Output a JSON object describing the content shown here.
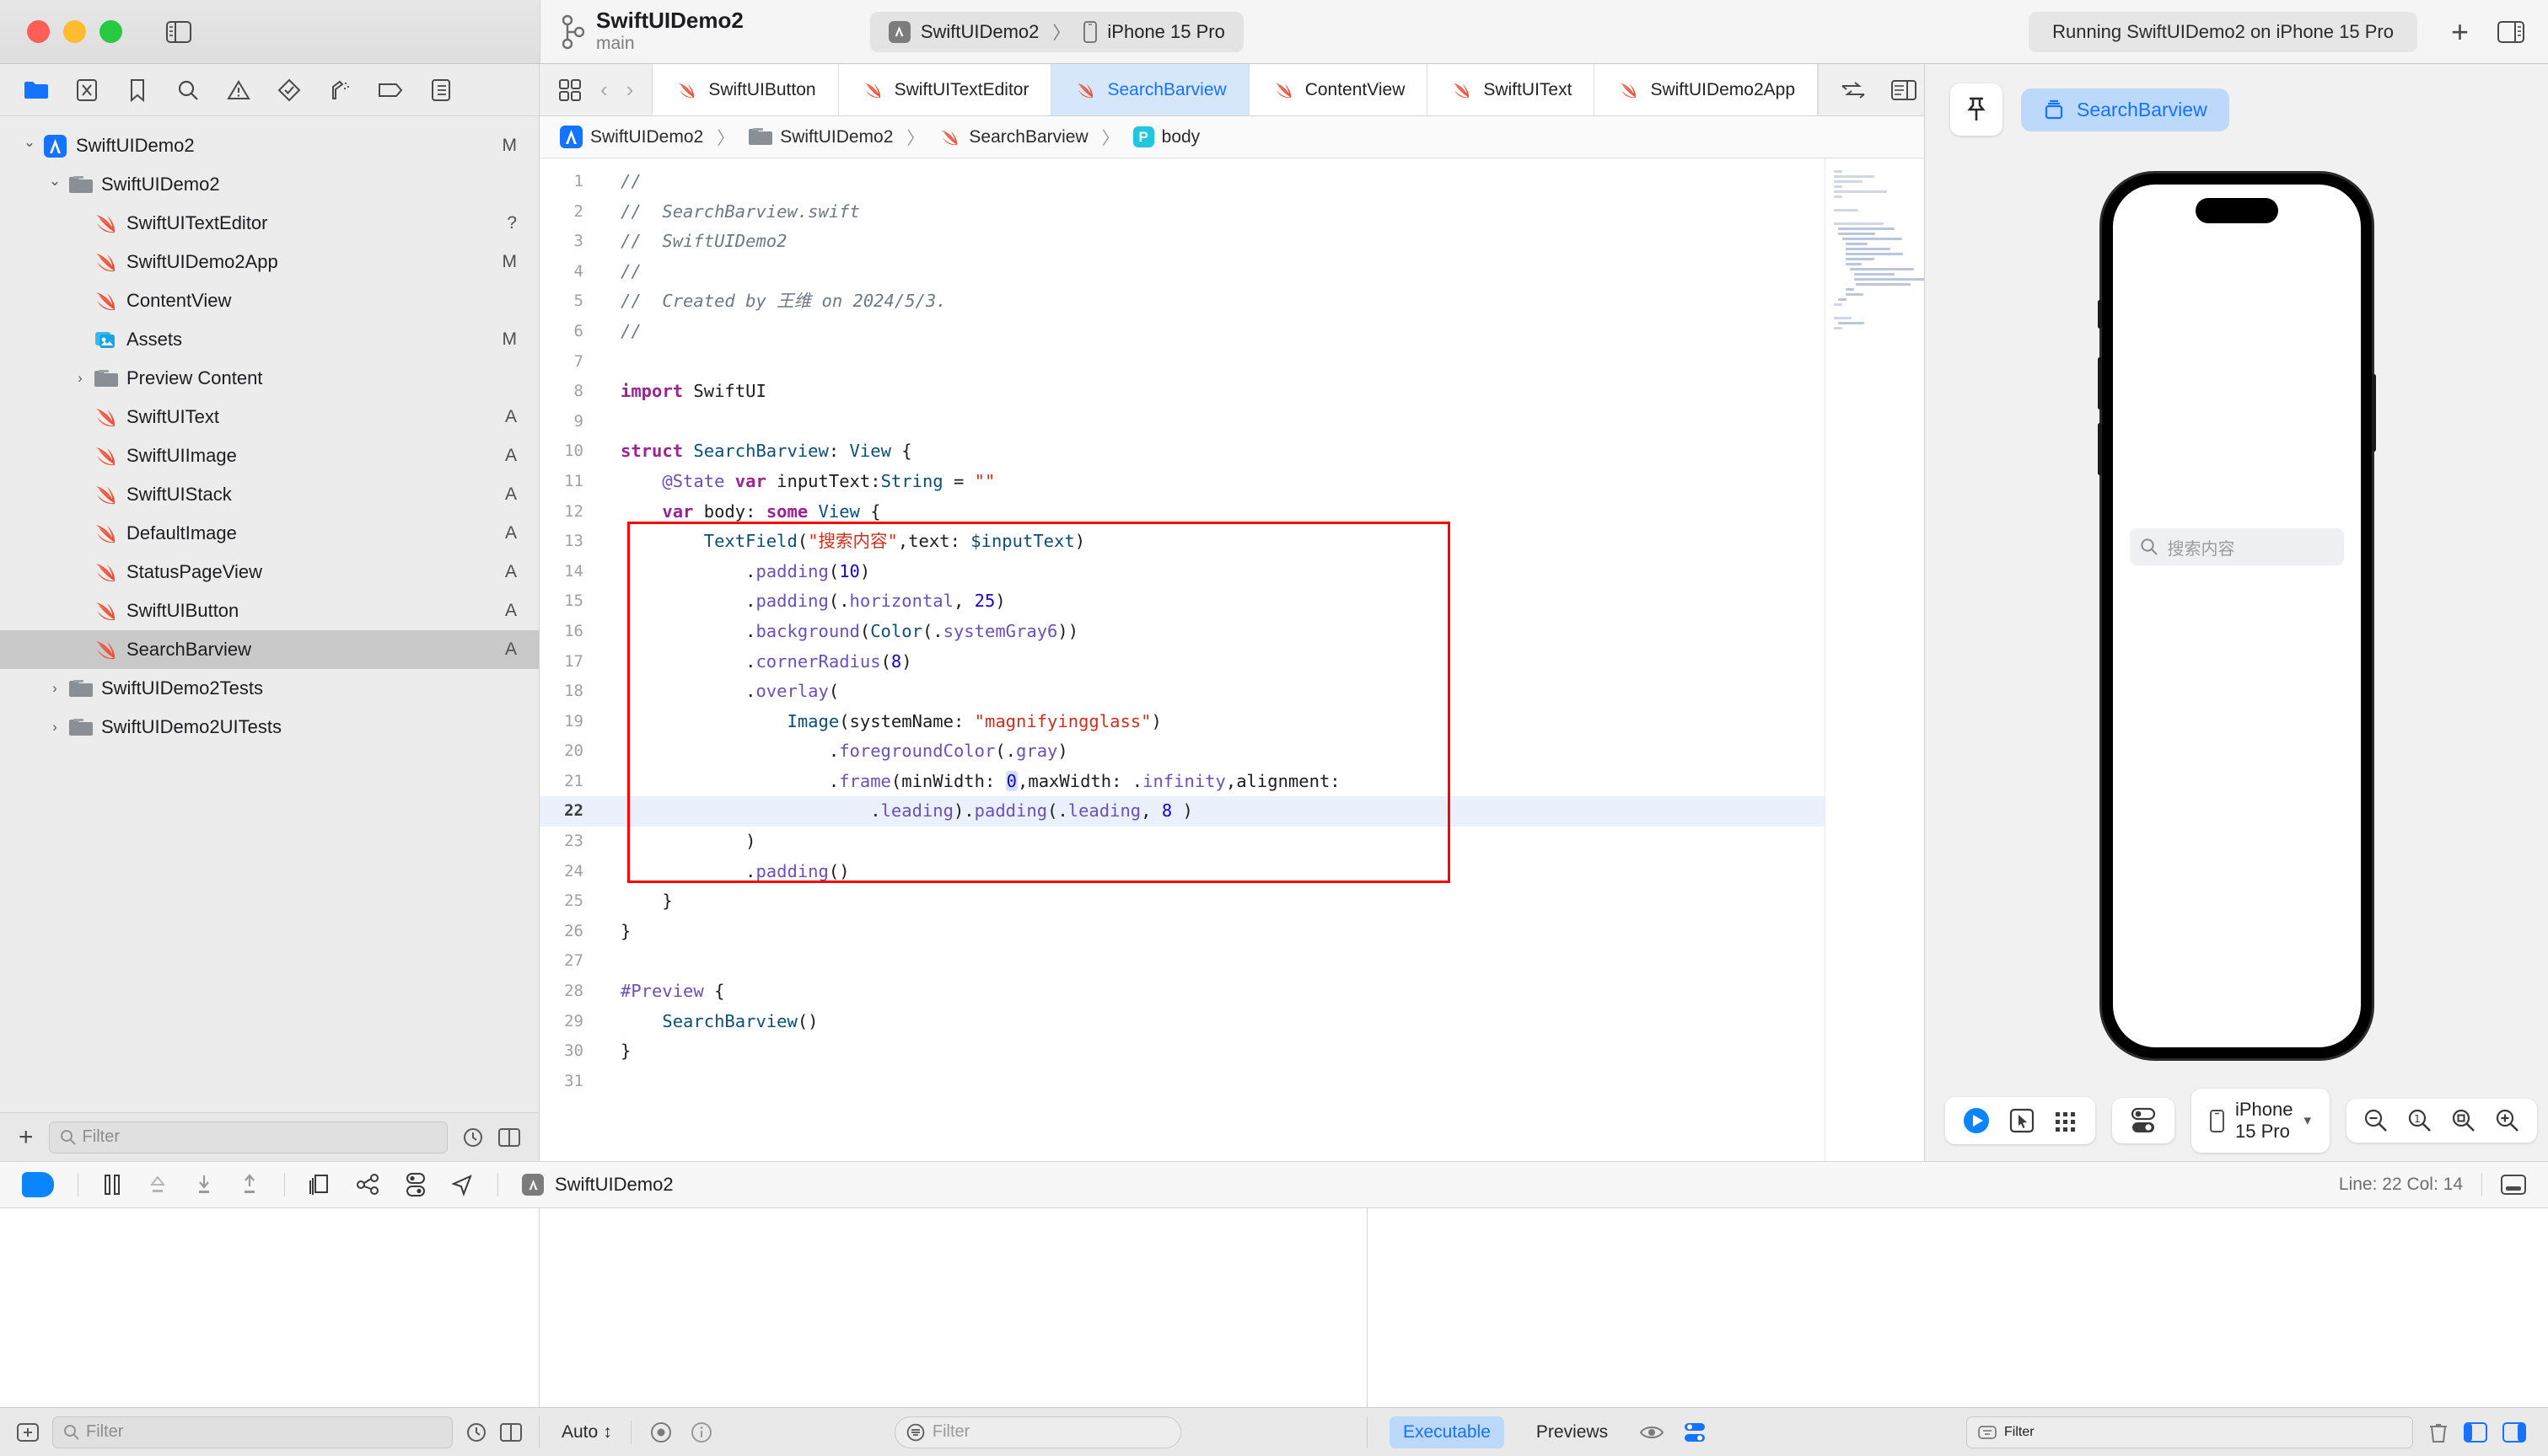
{
  "window": {
    "traffic_lights": [
      "close",
      "minimize",
      "zoom"
    ],
    "sidebar_toggle": "sidebar-toggle-icon",
    "stop_label": "stop-button",
    "run_label": "run-button"
  },
  "branch": {
    "project": "SwiftUIDemo2",
    "name": "main"
  },
  "scheme": {
    "target": "SwiftUIDemo2",
    "destination": "iPhone 15 Pro",
    "separator": "〉"
  },
  "activity": {
    "status": "Running SwiftUIDemo2 on iPhone 15 Pro"
  },
  "titlebar_actions": {
    "add": "+",
    "inspector_toggle": "inspector-toggle-icon"
  },
  "navigator": {
    "icons": [
      "folder-icon",
      "source-control-icon",
      "bookmark-icon",
      "search-icon",
      "warning-icon",
      "test-icon",
      "debug-icon",
      "breakpoint-icon",
      "report-icon"
    ],
    "tree": [
      {
        "label": "SwiftUIDemo2",
        "badge": "M",
        "icon": "app-icon",
        "depth": 0,
        "disclosure": "open",
        "selected": false
      },
      {
        "label": "SwiftUIDemo2",
        "badge": "",
        "icon": "folder-icon",
        "depth": 1,
        "disclosure": "open",
        "selected": false
      },
      {
        "label": "SwiftUITextEditor",
        "badge": "?",
        "icon": "swift-icon",
        "depth": 2,
        "disclosure": "",
        "selected": false
      },
      {
        "label": "SwiftUIDemo2App",
        "badge": "M",
        "icon": "swift-icon",
        "depth": 2,
        "disclosure": "",
        "selected": false
      },
      {
        "label": "ContentView",
        "badge": "",
        "icon": "swift-icon",
        "depth": 2,
        "disclosure": "",
        "selected": false
      },
      {
        "label": "Assets",
        "badge": "M",
        "icon": "assets-icon",
        "depth": 2,
        "disclosure": "",
        "selected": false
      },
      {
        "label": "Preview Content",
        "badge": "",
        "icon": "folder-icon",
        "depth": 2,
        "disclosure": "closed",
        "selected": false
      },
      {
        "label": "SwiftUIText",
        "badge": "A",
        "icon": "swift-icon",
        "depth": 2,
        "disclosure": "",
        "selected": false
      },
      {
        "label": "SwiftUIImage",
        "badge": "A",
        "icon": "swift-icon",
        "depth": 2,
        "disclosure": "",
        "selected": false
      },
      {
        "label": "SwiftUIStack",
        "badge": "A",
        "icon": "swift-icon",
        "depth": 2,
        "disclosure": "",
        "selected": false
      },
      {
        "label": "DefaultImage",
        "badge": "A",
        "icon": "swift-icon",
        "depth": 2,
        "disclosure": "",
        "selected": false
      },
      {
        "label": "StatusPageView",
        "badge": "A",
        "icon": "swift-icon",
        "depth": 2,
        "disclosure": "",
        "selected": false
      },
      {
        "label": "SwiftUIButton",
        "badge": "A",
        "icon": "swift-icon",
        "depth": 2,
        "disclosure": "",
        "selected": false
      },
      {
        "label": "SearchBarview",
        "badge": "A",
        "icon": "swift-icon",
        "depth": 2,
        "disclosure": "",
        "selected": true
      },
      {
        "label": "SwiftUIDemo2Tests",
        "badge": "",
        "icon": "folder-icon",
        "depth": 1,
        "disclosure": "closed",
        "selected": false
      },
      {
        "label": "SwiftUIDemo2UITests",
        "badge": "",
        "icon": "folder-icon",
        "depth": 1,
        "disclosure": "closed",
        "selected": false
      }
    ],
    "filter_placeholder": "Filter",
    "add_button": "+"
  },
  "tabs": [
    {
      "label": "SwiftUIButton",
      "active": false
    },
    {
      "label": "SwiftUITextEditor",
      "active": false
    },
    {
      "label": "SearchBarview",
      "active": true
    },
    {
      "label": "ContentView",
      "active": false
    },
    {
      "label": "SwiftUIText",
      "active": false
    },
    {
      "label": "SwiftUIDemo2App",
      "active": false
    }
  ],
  "breadcrumb": [
    {
      "label": "SwiftUIDemo2",
      "icon": "app-icon"
    },
    {
      "label": "SwiftUIDemo2",
      "icon": "folder-icon"
    },
    {
      "label": "SearchBarview",
      "icon": "swift-icon"
    },
    {
      "label": "body",
      "icon": "property-badge"
    }
  ],
  "code": {
    "current_line": 22,
    "lines": [
      {
        "n": 1,
        "fold": false,
        "tokens": [
          {
            "t": "com",
            "v": "//"
          }
        ]
      },
      {
        "n": 2,
        "fold": true,
        "tokens": [
          {
            "t": "com",
            "v": "//  SearchBarview.swift"
          }
        ]
      },
      {
        "n": 3,
        "fold": true,
        "tokens": [
          {
            "t": "com",
            "v": "//  SwiftUIDemo2"
          }
        ]
      },
      {
        "n": 4,
        "fold": true,
        "tokens": [
          {
            "t": "com",
            "v": "//"
          }
        ]
      },
      {
        "n": 5,
        "fold": true,
        "tokens": [
          {
            "t": "com",
            "v": "//  Created by 王维 on 2024/5/3."
          }
        ]
      },
      {
        "n": 6,
        "fold": true,
        "tokens": [
          {
            "t": "com",
            "v": "//"
          }
        ]
      },
      {
        "n": 7,
        "fold": false,
        "tokens": []
      },
      {
        "n": 8,
        "fold": false,
        "tokens": [
          {
            "t": "kw",
            "v": "import"
          },
          {
            "t": "plain",
            "v": " SwiftUI"
          }
        ]
      },
      {
        "n": 9,
        "fold": false,
        "tokens": []
      },
      {
        "n": 10,
        "fold": true,
        "tokens": [
          {
            "t": "kw",
            "v": "struct"
          },
          {
            "t": "plain",
            "v": " "
          },
          {
            "t": "type",
            "v": "SearchBarview"
          },
          {
            "t": "plain",
            "v": ": "
          },
          {
            "t": "type",
            "v": "View"
          },
          {
            "t": "plain",
            "v": " {"
          }
        ]
      },
      {
        "n": 11,
        "fold": true,
        "tokens": [
          {
            "t": "plain",
            "v": "    "
          },
          {
            "t": "attr",
            "v": "@State"
          },
          {
            "t": "plain",
            "v": " "
          },
          {
            "t": "kw",
            "v": "var"
          },
          {
            "t": "plain",
            "v": " inputText:"
          },
          {
            "t": "type",
            "v": "String"
          },
          {
            "t": "plain",
            "v": " = "
          },
          {
            "t": "str",
            "v": "\"\""
          }
        ]
      },
      {
        "n": 12,
        "fold": true,
        "tokens": [
          {
            "t": "plain",
            "v": "    "
          },
          {
            "t": "kw",
            "v": "var"
          },
          {
            "t": "plain",
            "v": " body: "
          },
          {
            "t": "kw",
            "v": "some"
          },
          {
            "t": "plain",
            "v": " "
          },
          {
            "t": "type",
            "v": "View"
          },
          {
            "t": "plain",
            "v": " {"
          }
        ]
      },
      {
        "n": 13,
        "fold": true,
        "tokens": [
          {
            "t": "plain",
            "v": "        "
          },
          {
            "t": "type",
            "v": "TextField"
          },
          {
            "t": "plain",
            "v": "("
          },
          {
            "t": "str",
            "v": "\"搜索内容\""
          },
          {
            "t": "plain",
            "v": ",text: "
          },
          {
            "t": "type",
            "v": "$inputText"
          },
          {
            "t": "plain",
            "v": ")"
          }
        ]
      },
      {
        "n": 14,
        "fold": false,
        "tokens": [
          {
            "t": "plain",
            "v": "            ."
          },
          {
            "t": "meth",
            "v": "padding"
          },
          {
            "t": "plain",
            "v": "("
          },
          {
            "t": "num",
            "v": "10"
          },
          {
            "t": "plain",
            "v": ")"
          }
        ]
      },
      {
        "n": 15,
        "fold": false,
        "tokens": [
          {
            "t": "plain",
            "v": "            ."
          },
          {
            "t": "meth",
            "v": "padding"
          },
          {
            "t": "plain",
            "v": "(."
          },
          {
            "t": "meth",
            "v": "horizontal"
          },
          {
            "t": "plain",
            "v": ", "
          },
          {
            "t": "num",
            "v": "25"
          },
          {
            "t": "plain",
            "v": ")"
          }
        ]
      },
      {
        "n": 16,
        "fold": false,
        "tokens": [
          {
            "t": "plain",
            "v": "            ."
          },
          {
            "t": "meth",
            "v": "background"
          },
          {
            "t": "plain",
            "v": "("
          },
          {
            "t": "type",
            "v": "Color"
          },
          {
            "t": "plain",
            "v": "(."
          },
          {
            "t": "meth",
            "v": "systemGray6"
          },
          {
            "t": "plain",
            "v": "))"
          }
        ]
      },
      {
        "n": 17,
        "fold": false,
        "tokens": [
          {
            "t": "plain",
            "v": "            ."
          },
          {
            "t": "meth",
            "v": "cornerRadius"
          },
          {
            "t": "plain",
            "v": "("
          },
          {
            "t": "num",
            "v": "8"
          },
          {
            "t": "plain",
            "v": ")"
          }
        ]
      },
      {
        "n": 18,
        "fold": false,
        "tokens": [
          {
            "t": "plain",
            "v": "            ."
          },
          {
            "t": "meth",
            "v": "overlay"
          },
          {
            "t": "plain",
            "v": "("
          }
        ]
      },
      {
        "n": 19,
        "fold": false,
        "tokens": [
          {
            "t": "plain",
            "v": "                "
          },
          {
            "t": "type",
            "v": "Image"
          },
          {
            "t": "plain",
            "v": "(systemName: "
          },
          {
            "t": "str",
            "v": "\"magnifyingglass\""
          },
          {
            "t": "plain",
            "v": ")"
          }
        ]
      },
      {
        "n": 20,
        "fold": false,
        "tokens": [
          {
            "t": "plain",
            "v": "                    ."
          },
          {
            "t": "meth",
            "v": "foregroundColor"
          },
          {
            "t": "plain",
            "v": "(."
          },
          {
            "t": "meth",
            "v": "gray"
          },
          {
            "t": "plain",
            "v": ")"
          }
        ]
      },
      {
        "n": 21,
        "fold": false,
        "tokens": [
          {
            "t": "plain",
            "v": "                    ."
          },
          {
            "t": "meth",
            "v": "frame"
          },
          {
            "t": "plain",
            "v": "(minWidth: "
          },
          {
            "t": "numsel",
            "v": "0"
          },
          {
            "t": "plain",
            "v": ",maxWidth: ."
          },
          {
            "t": "meth",
            "v": "infinity"
          },
          {
            "t": "plain",
            "v": ",alignment:"
          }
        ]
      },
      {
        "n": 22,
        "fold": false,
        "tokens": [
          {
            "t": "plain",
            "v": "                        ."
          },
          {
            "t": "meth",
            "v": "leading"
          },
          {
            "t": "plain",
            "v": ")."
          },
          {
            "t": "meth",
            "v": "padding"
          },
          {
            "t": "plain",
            "v": "(."
          },
          {
            "t": "meth",
            "v": "leading"
          },
          {
            "t": "plain",
            "v": ", "
          },
          {
            "t": "num",
            "v": "8"
          },
          {
            "t": "plain",
            "v": " )"
          }
        ]
      },
      {
        "n": 23,
        "fold": false,
        "tokens": [
          {
            "t": "plain",
            "v": "            )"
          }
        ]
      },
      {
        "n": 24,
        "fold": false,
        "tokens": [
          {
            "t": "plain",
            "v": "            ."
          },
          {
            "t": "meth",
            "v": "padding"
          },
          {
            "t": "plain",
            "v": "()"
          }
        ]
      },
      {
        "n": 25,
        "fold": true,
        "tokens": [
          {
            "t": "plain",
            "v": "    }"
          }
        ]
      },
      {
        "n": 26,
        "fold": true,
        "tokens": [
          {
            "t": "plain",
            "v": "}"
          }
        ]
      },
      {
        "n": 27,
        "fold": false,
        "tokens": []
      },
      {
        "n": 28,
        "fold": true,
        "tokens": [
          {
            "t": "meth",
            "v": "#Preview"
          },
          {
            "t": "plain",
            "v": " {"
          }
        ]
      },
      {
        "n": 29,
        "fold": true,
        "tokens": [
          {
            "t": "plain",
            "v": "    "
          },
          {
            "t": "type",
            "v": "SearchBarview"
          },
          {
            "t": "plain",
            "v": "()"
          }
        ]
      },
      {
        "n": 30,
        "fold": true,
        "tokens": [
          {
            "t": "plain",
            "v": "}"
          }
        ]
      },
      {
        "n": 31,
        "fold": false,
        "tokens": []
      }
    ],
    "highlight_box_color": "#ff0000"
  },
  "canvas": {
    "pin_icon": "pin-icon",
    "preview_name": "SearchBarview",
    "device_frame": "iPhone 15 Pro",
    "rendered": {
      "search_placeholder": "搜索内容",
      "search_icon": "magnifyingglass-icon"
    },
    "controls": {
      "play": "play-icon",
      "select": "pointer-icon",
      "variants": "grid-icon",
      "device_settings": "toggles-icon",
      "device_label": "iPhone 15 Pro",
      "zoom_out": "zoom-out-icon",
      "zoom_100": "zoom-100-icon",
      "zoom_fit": "zoom-fit-icon",
      "zoom_in": "zoom-in-icon"
    }
  },
  "debugbar": {
    "icons": [
      "continue-icon",
      "pause-icon",
      "step-over-icon",
      "step-into-icon",
      "step-out-icon",
      "view-hierarchy-icon",
      "memory-graph-icon",
      "environment-overrides-icon",
      "location-icon"
    ],
    "process": "SwiftUIDemo2",
    "line_col": "Line: 22  Col: 14",
    "console_toggle": "console-toggle-icon"
  },
  "statusbar": {
    "auto_label": "Auto",
    "eye_icon": "eye-icon",
    "info_icon": "info-icon",
    "filter_placeholder": "Filter",
    "tabs": [
      {
        "label": "Executable",
        "active": true
      },
      {
        "label": "Previews",
        "active": false
      }
    ],
    "right_filter_placeholder": "Filter",
    "trash_icon": "trash-icon",
    "panel_icons": [
      "left-panel-icon",
      "right-panel-icon"
    ]
  }
}
